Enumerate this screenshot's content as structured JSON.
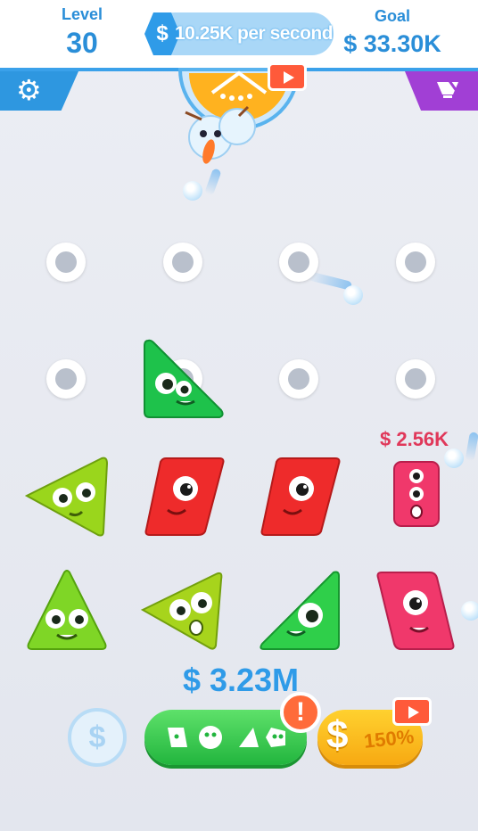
{
  "hud": {
    "level_label": "Level",
    "level_value": "30",
    "rate_currency": "$",
    "rate_text": "10.25K per second",
    "goal_label": "Goal",
    "goal_value": "$ 33.30K"
  },
  "buttons": {
    "settings_icon": "gear-icon",
    "shop_icon": "bowl-icon"
  },
  "board": {
    "floating_earning": "$ 2.56K",
    "money_total": "$ 3.23M"
  },
  "bottom_bar": {
    "recycle_symbol": "$",
    "alert_symbol": "!",
    "boost_symbol": "$",
    "boost_percent": "150%"
  },
  "colors": {
    "accent_blue": "#2f9be8",
    "settings_blue": "#2e97e0",
    "shop_purple": "#a13fd5",
    "buy_green": "#22b53e",
    "boost_orange": "#f7a912",
    "alert_orange": "#ff6b3a",
    "earning_pink": "#e0385a"
  }
}
